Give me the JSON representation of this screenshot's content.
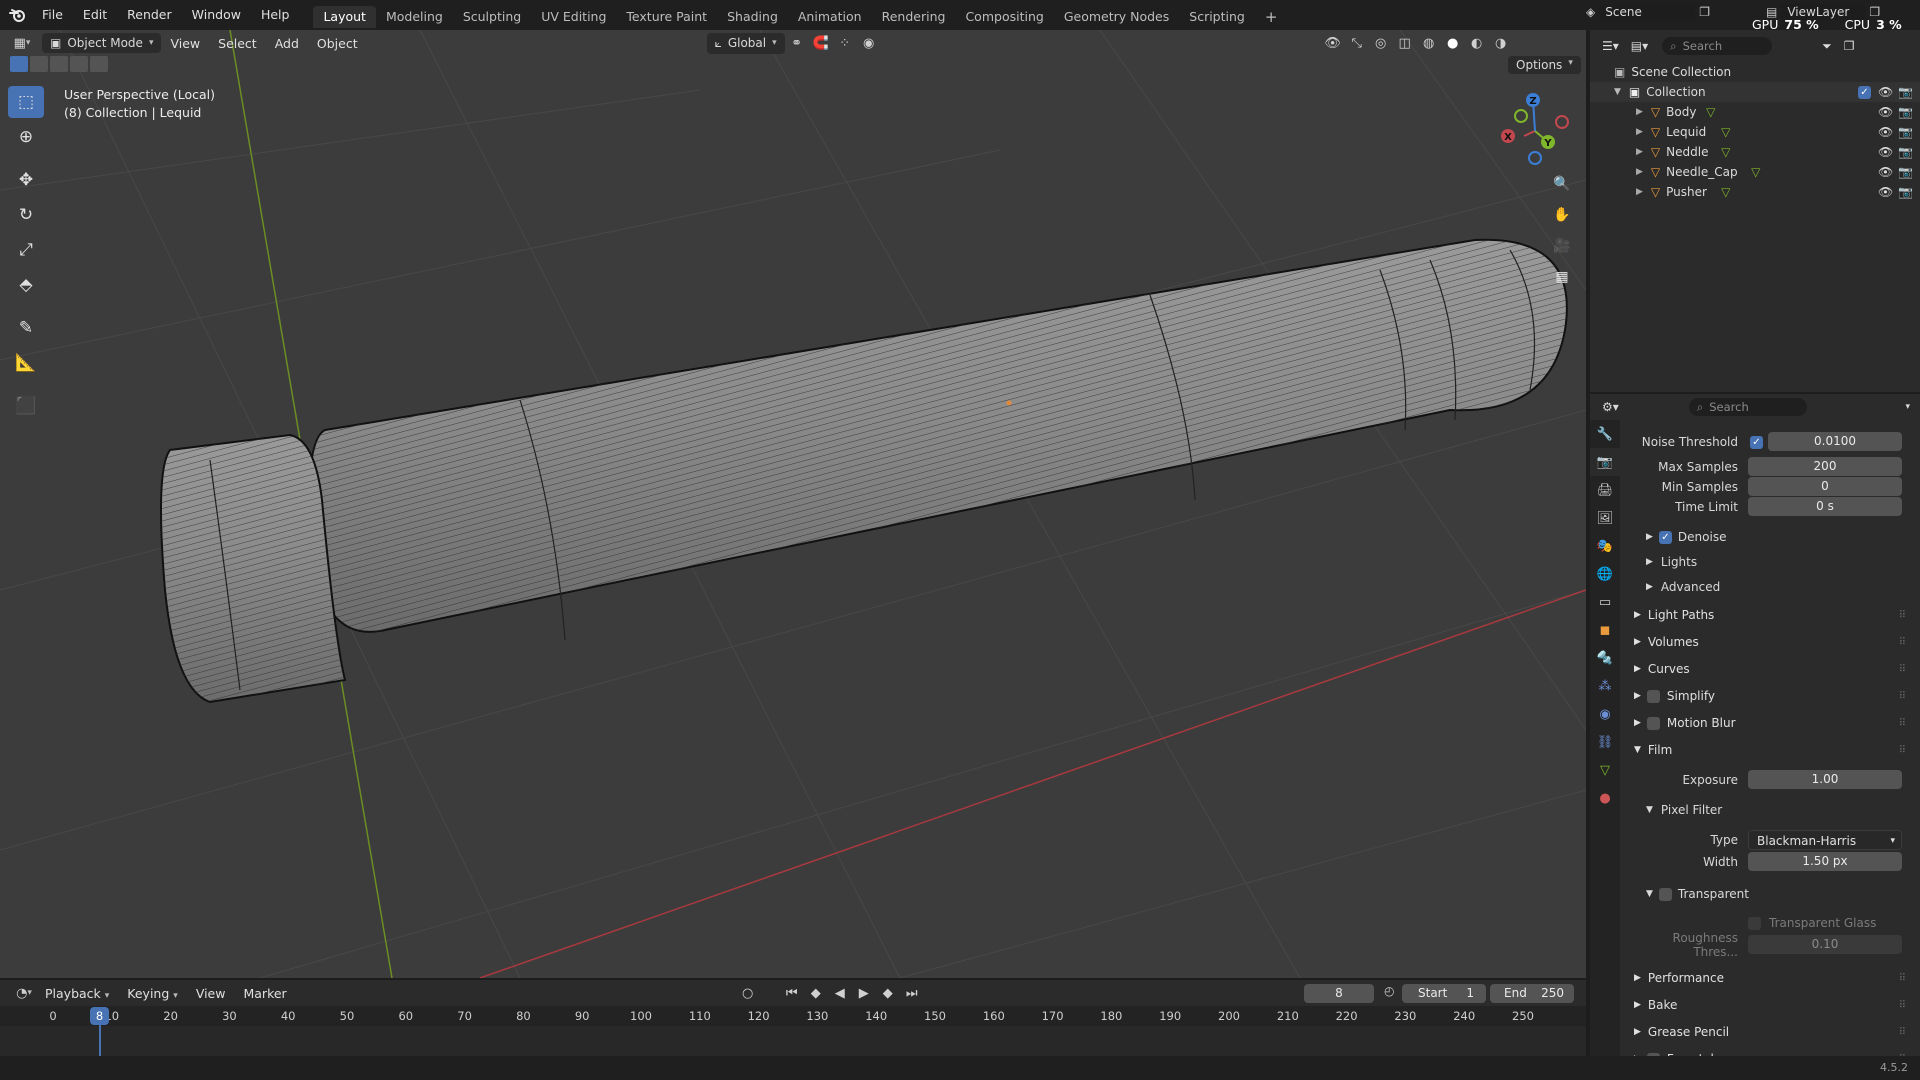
{
  "app": {
    "menu": [
      "File",
      "Edit",
      "Render",
      "Window",
      "Help"
    ],
    "workspaces": [
      "Layout",
      "Modeling",
      "Sculpting",
      "UV Editing",
      "Texture Paint",
      "Shading",
      "Animation",
      "Rendering",
      "Compositing",
      "Geometry Nodes",
      "Scripting"
    ],
    "active_workspace": "Layout",
    "scene": "Scene",
    "view_layer": "ViewLayer",
    "gpu_label": "GPU",
    "gpu_value": "75 %",
    "cpu_label": "CPU",
    "cpu_value": "3 %",
    "version": "4.5.2"
  },
  "viewport": {
    "mode": "Object Mode",
    "menus": [
      "View",
      "Select",
      "Add",
      "Object"
    ],
    "orientation": "Global",
    "options_label": "Options",
    "info_line1": "User Perspective (Local)",
    "info_line2": "(8) Collection | Lequid",
    "gizmo_axes": [
      "X",
      "Y",
      "Z"
    ],
    "colors": {
      "x_axis": "#c3474f",
      "y_axis": "#7fb62b",
      "z_axis": "#3b7ed6",
      "active": "#4772b3"
    }
  },
  "outliner": {
    "search_placeholder": "Search",
    "scene_collection": "Scene Collection",
    "collection": "Collection",
    "objects": [
      "Body",
      "Lequid",
      "Neddle",
      "Needle_Cap",
      "Pusher"
    ]
  },
  "properties": {
    "search_placeholder": "Search",
    "noise_threshold_label": "Noise Threshold",
    "noise_threshold": "0.0100",
    "max_samples_label": "Max Samples",
    "max_samples": "200",
    "min_samples_label": "Min Samples",
    "min_samples": "0",
    "time_limit_label": "Time Limit",
    "time_limit": "0 s",
    "denoise": "Denoise",
    "lights": "Lights",
    "advanced": "Advanced",
    "panels_top": [
      "Light Paths",
      "Volumes",
      "Curves",
      "Simplify",
      "Motion Blur",
      "Film"
    ],
    "exposure_label": "Exposure",
    "exposure": "1.00",
    "pixel_filter": "Pixel Filter",
    "type_label": "Type",
    "type_value": "Blackman-Harris",
    "width_label": "Width",
    "width_value": "1.50 px",
    "transparent": "Transparent",
    "transparent_glass": "Transparent Glass",
    "roughness_label": "Roughness Thres...",
    "roughness_value": "0.10",
    "panels_bottom": [
      "Performance",
      "Bake",
      "Grease Pencil",
      "Freestyle"
    ]
  },
  "timeline": {
    "menus": [
      "Playback",
      "Keying",
      "View",
      "Marker"
    ],
    "current_frame": "8",
    "start_label": "Start",
    "start": "1",
    "end_label": "End",
    "end": "250",
    "ruler": [
      "0",
      "10",
      "20",
      "30",
      "40",
      "50",
      "60",
      "70",
      "80",
      "90",
      "100",
      "110",
      "120",
      "130",
      "140",
      "150",
      "160",
      "170",
      "180",
      "190",
      "200",
      "210",
      "220",
      "230",
      "240",
      "250"
    ]
  }
}
